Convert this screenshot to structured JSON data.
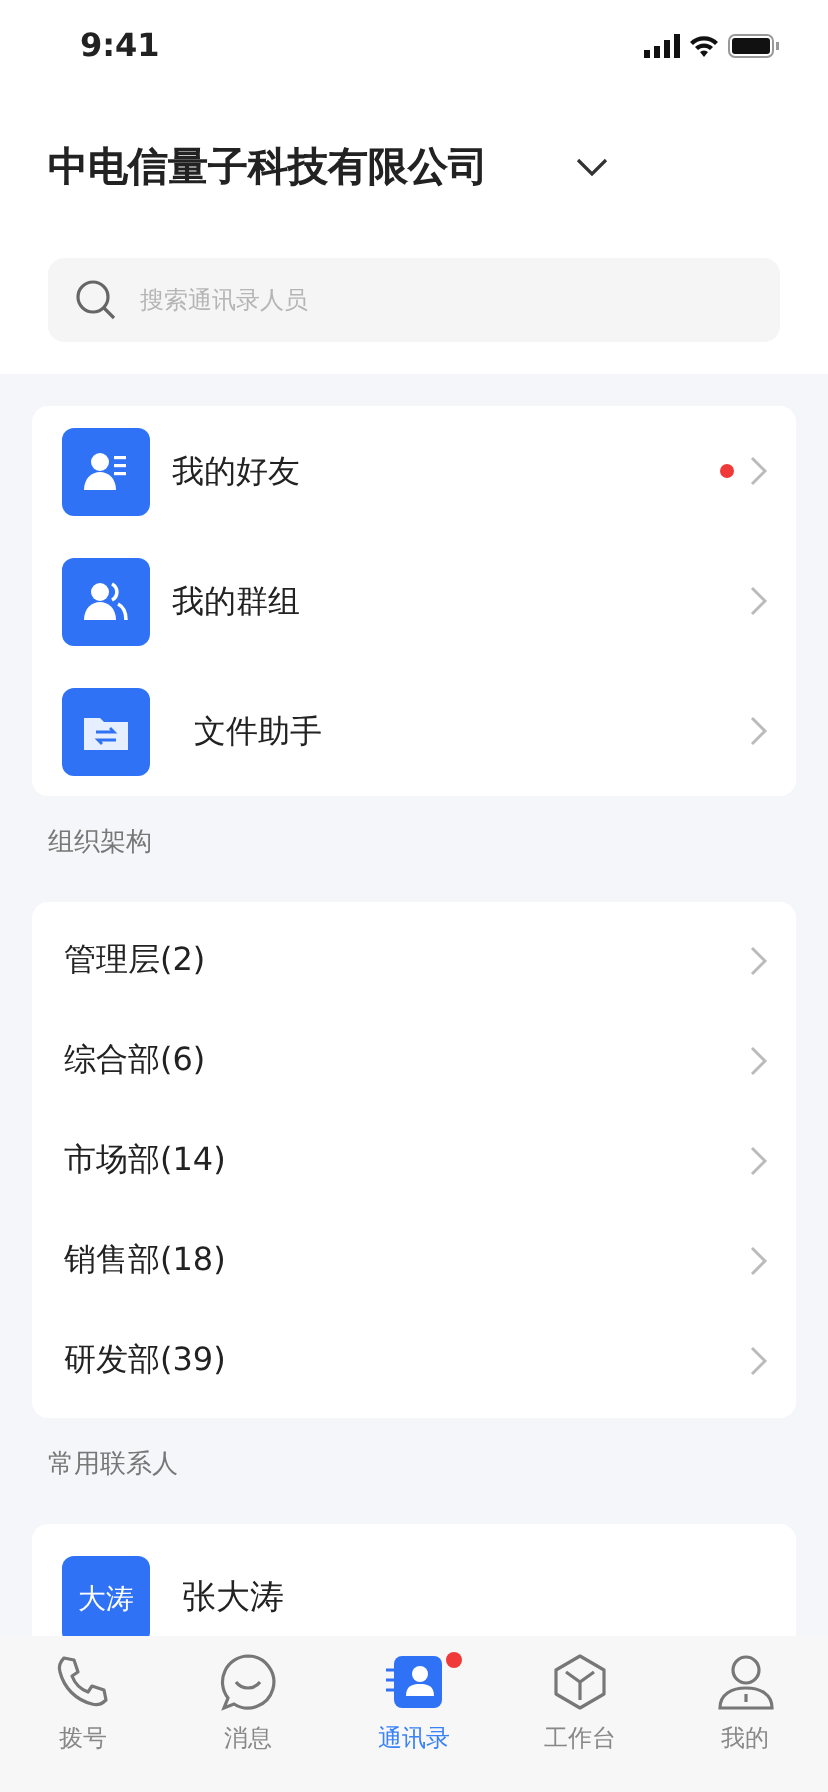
{
  "status_bar": {
    "time": "9:41"
  },
  "header": {
    "company": "中电信量子科技有限公司",
    "search": {
      "placeholder": "搜索通讯录人员"
    }
  },
  "quick_items": [
    {
      "kind": "friends",
      "label": "我的好友",
      "unread": true
    },
    {
      "kind": "groups",
      "label": "我的群组",
      "unread": false
    },
    {
      "kind": "files",
      "label": "文件助手",
      "unread": false
    }
  ],
  "org_section": {
    "title": "组织架构",
    "departments": [
      {
        "label": "管理层(2)"
      },
      {
        "label": "综合部(6)"
      },
      {
        "label": "市场部(14)"
      },
      {
        "label": "销售部(18)"
      },
      {
        "label": "研发部(39)"
      }
    ]
  },
  "contacts_section": {
    "title": "常用联系人",
    "contacts": [
      {
        "avatar_text": "大涛",
        "name": "张大涛"
      }
    ]
  },
  "tab_bar": [
    {
      "kind": "phone",
      "label": "拨号",
      "selected": false,
      "unread": false
    },
    {
      "kind": "chat",
      "label": "消息",
      "selected": false,
      "unread": false
    },
    {
      "kind": "contacts",
      "label": "通讯录",
      "selected": true,
      "unread": true
    },
    {
      "kind": "workbench",
      "label": "工作台",
      "selected": false,
      "unread": false
    },
    {
      "kind": "me",
      "label": "我的",
      "selected": false,
      "unread": false
    }
  ]
}
